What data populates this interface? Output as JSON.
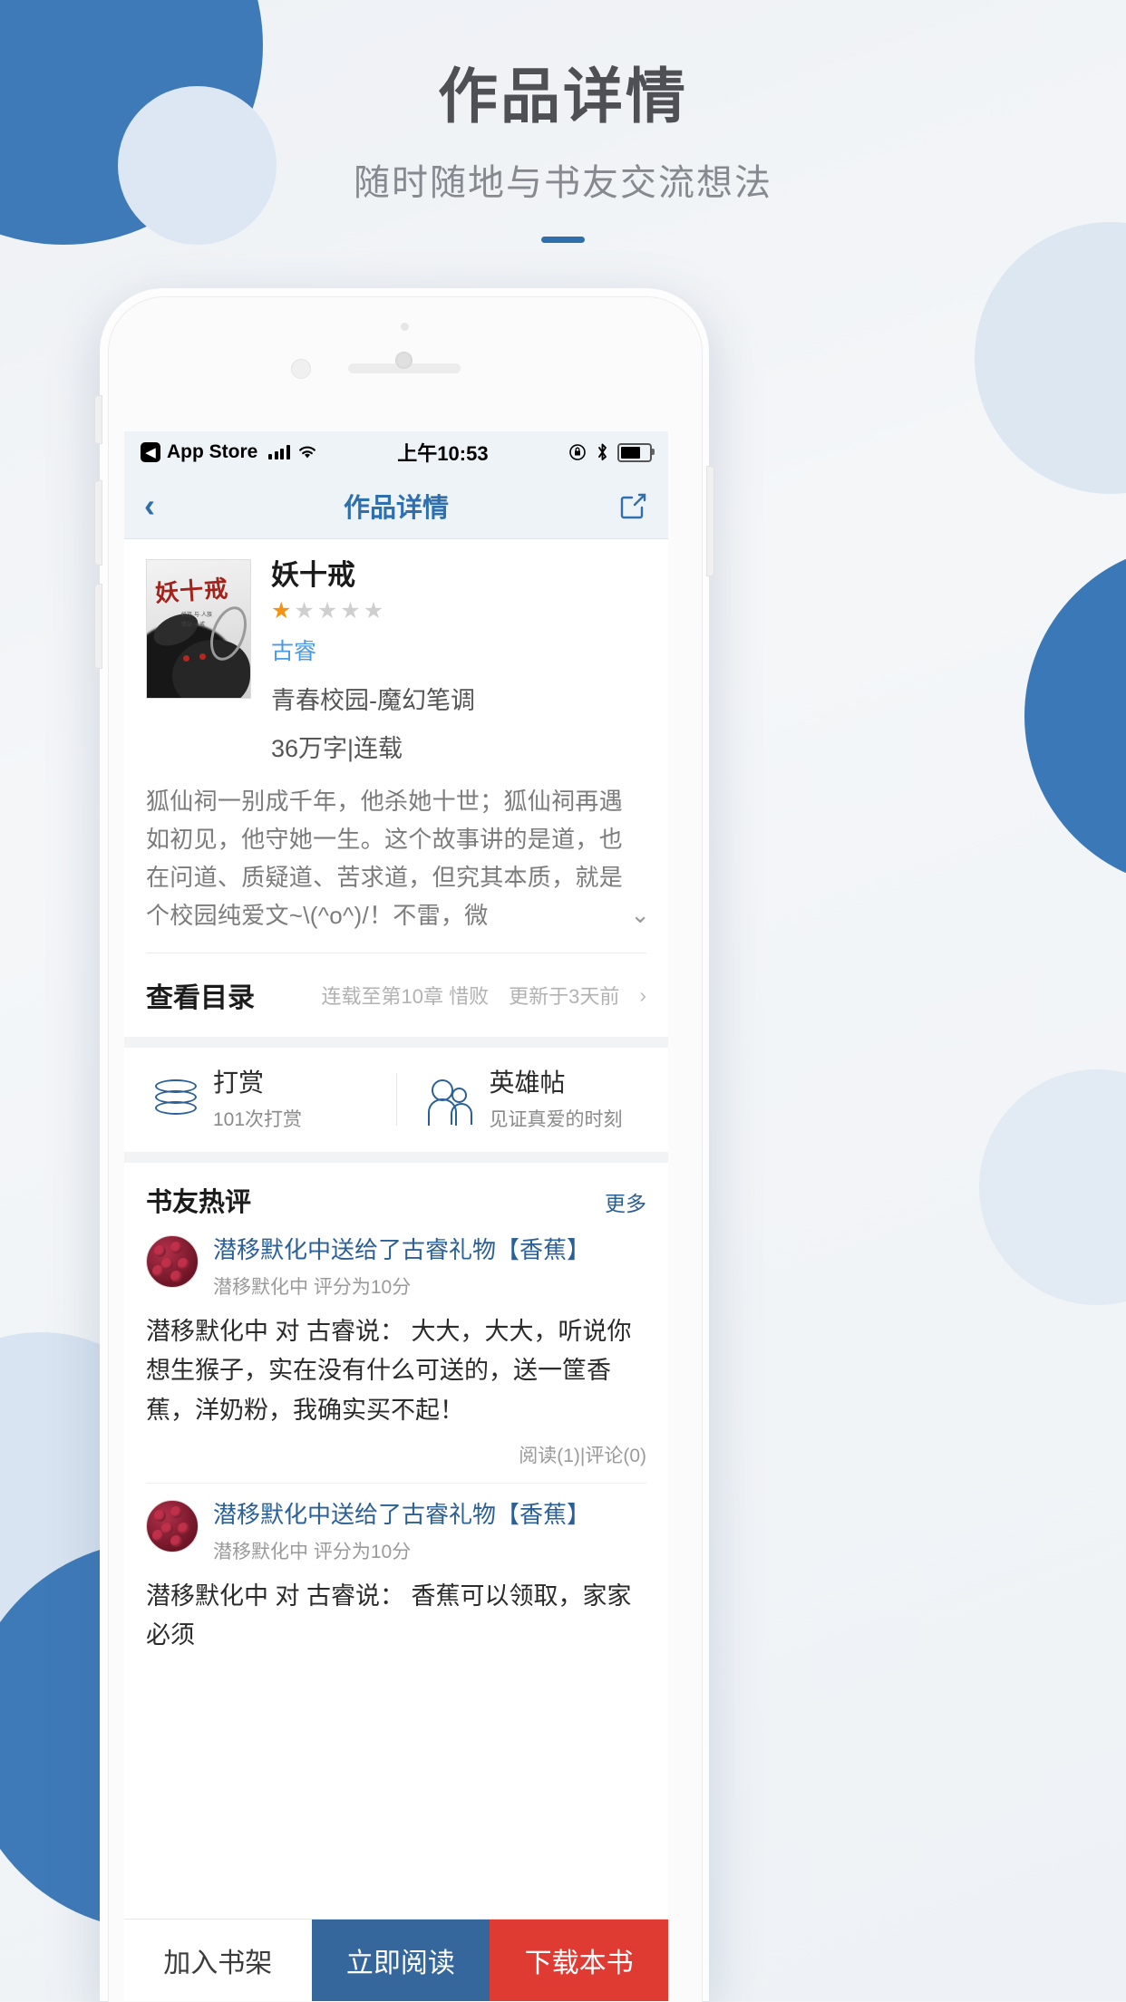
{
  "promo": {
    "title": "作品详情",
    "subtitle": "随时随地与书友交流想法"
  },
  "statusbar": {
    "carrier_label": "App Store",
    "time": "上午10:53",
    "icons": [
      "signal-bars-icon",
      "wifi-icon",
      "rotation-lock-icon",
      "bluetooth-icon",
      "battery-icon"
    ]
  },
  "navbar": {
    "back_icon": "chevron-left-icon",
    "title": "作品详情",
    "share_icon": "share-external-icon"
  },
  "book": {
    "cover_title": "妖十戒",
    "cover_sub1": "妖族·与·人族",
    "cover_sub2": "情劫·十戒",
    "title": "妖十戒",
    "rating": 1,
    "rating_max": 5,
    "star_on_color": "#f39313",
    "star_off_color": "#cfcfcf",
    "author": "古睿",
    "category": "青春校园-魔幻笔调",
    "wordcount": "36万字|连载",
    "description": "狐仙祠一别成千年，他杀她十世；狐仙祠再遇如初见，他守她一生。这个故事讲的是道，也在问道、质疑道、苦求道，但究其本质，就是个校园纯爱文~\\(^o^)/！不雷，微",
    "expand_icon": "chevron-down-icon"
  },
  "catalog": {
    "label": "查看目录",
    "progress": "连载至第10章 惜败",
    "updated": "更新于3天前",
    "chevron": "›"
  },
  "actions": [
    {
      "icon": "coin-stack-icon",
      "title": "打赏",
      "subtitle": "101次打赏"
    },
    {
      "icon": "two-people-icon",
      "title": "英雄帖",
      "subtitle": "见证真爱的时刻"
    }
  ],
  "comments": {
    "heading": "书友热评",
    "more_label": "更多",
    "items": [
      {
        "title": "潜移默化中送给了古睿礼物【香蕉】",
        "meta": "潜移默化中  评分为10分",
        "text": "潜移默化中 对 古睿说： 大大，大大，听说你想生猴子，实在没有什么可送的，送一筐香蕉，洋奶粉，我确实买不起！",
        "footer": "阅读(1)|评论(0)"
      },
      {
        "title": "潜移默化中送给了古睿礼物【香蕉】",
        "meta": "潜移默化中  评分为10分",
        "text": "潜移默化中 对 古睿说： 香蕉可以领取，家家必须",
        "footer": ""
      }
    ]
  },
  "bottombar": {
    "shelf_label": "加入书架",
    "read_label": "立即阅读",
    "download_label": "下载本书",
    "read_color": "#35679c",
    "download_color": "#e03b33"
  }
}
